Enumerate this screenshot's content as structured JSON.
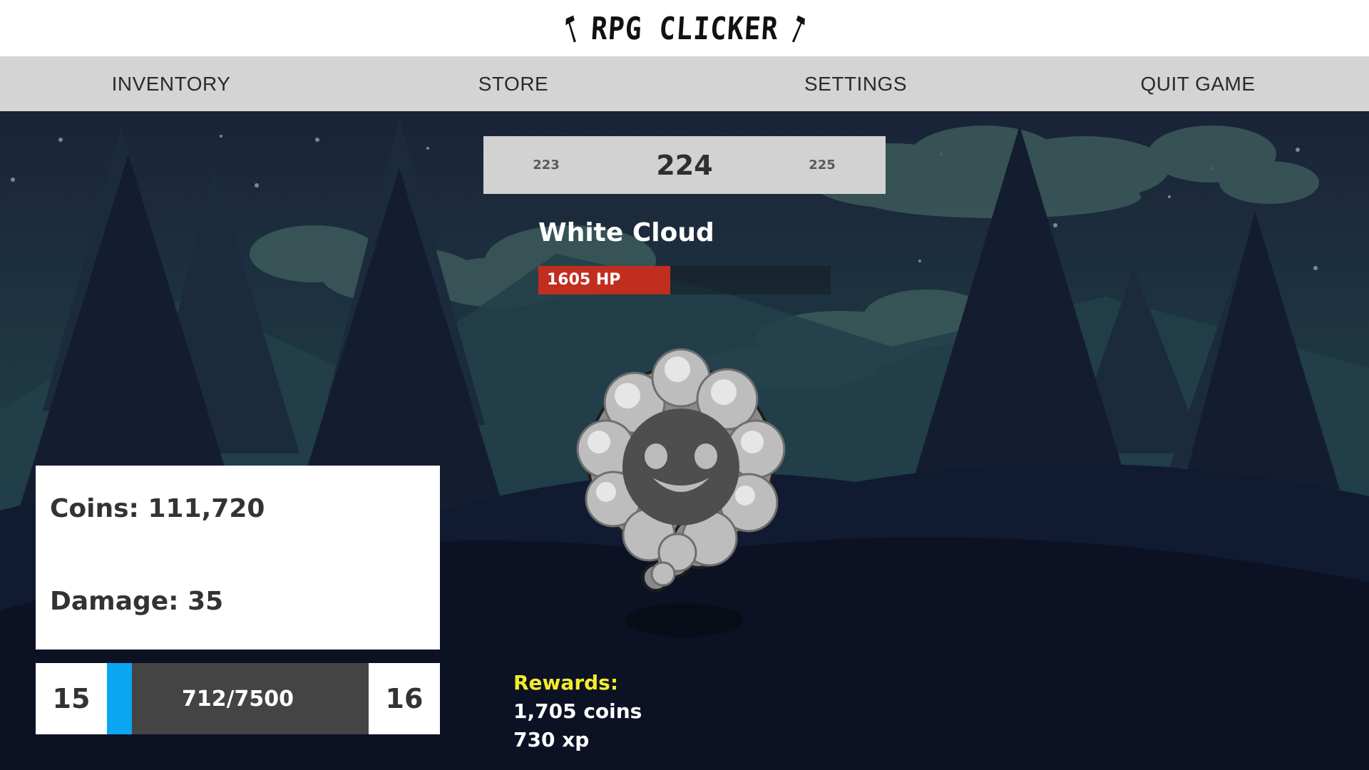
{
  "header": {
    "title": "RPG CLICKER"
  },
  "nav": {
    "items": [
      {
        "label": "INVENTORY"
      },
      {
        "label": "STORE"
      },
      {
        "label": "SETTINGS"
      },
      {
        "label": "QUIT GAME"
      }
    ]
  },
  "level_selector": {
    "previous": "223",
    "current": "224",
    "next": "225"
  },
  "monster": {
    "name": "White Cloud",
    "hp_text": "1605 HP",
    "hp_fraction": 0.45
  },
  "stats": {
    "coins": "Coins: 111,720",
    "damage": "Damage: 35"
  },
  "xp": {
    "current_level": "15",
    "next_level": "16",
    "progress_text": "712/7500",
    "progress_fraction": 0.095
  },
  "rewards": {
    "title": "Rewards:",
    "coins": "1,705 coins",
    "xp": "730 xp"
  },
  "colors": {
    "hp_bar": "#c12d1e",
    "xp_bar": "#0aa6f2",
    "rewards_title": "#f5ec2c"
  }
}
